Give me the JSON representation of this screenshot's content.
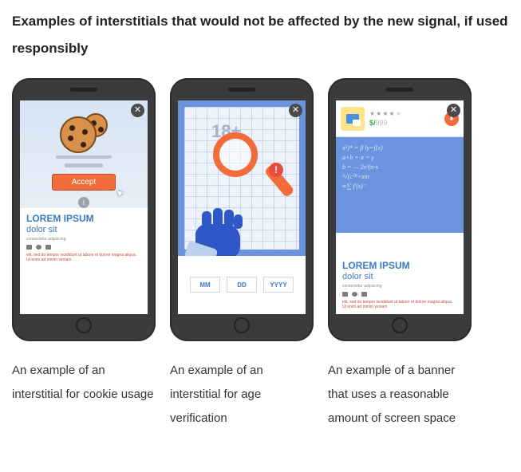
{
  "heading": "Examples of interstitials that would not be affected by the new signal, if used responsibly",
  "phones": {
    "cookie": {
      "accept_label": "Accept",
      "info_symbol": "i",
      "article": {
        "title": "LOREM IPSUM",
        "subtitle": "dolor sit",
        "meta": "consectetur adipiscing",
        "redtext": "elit, sed do tempor incididunt ut labore et dolore magna aliqua. Ut enim ad minim veniam"
      },
      "caption": "An example of an interstitial for cookie usage"
    },
    "age": {
      "badge": "18+",
      "alert_symbol": "!",
      "fields": {
        "mm": "MM",
        "dd": "DD",
        "yyyy": "YYYY"
      },
      "caption": "An example of an interstitial for age verification"
    },
    "banner": {
      "stars_shown": 4,
      "price_currency": "$/",
      "price_value": "999",
      "download_symbol": "⬇",
      "chalk_lines": [
        "x⁵)* = β        ly=f(x)",
        "a+b  = α      = γ",
        " b   = —        2x²(n-s",
        "³√(c⁰⁹+sin",
        "   ∞∑               f'(s)⁻"
      ],
      "article": {
        "title": "LOREM IPSUM",
        "subtitle": "dolor sit",
        "meta": "consectetur adipiscing",
        "redtext": "elit, sed do tempor incididunt ut labore et dolore magna aliqua. Ut enim ad minim veniam"
      },
      "caption": "An example of a banner that uses a reasonable amount of screen space"
    }
  }
}
